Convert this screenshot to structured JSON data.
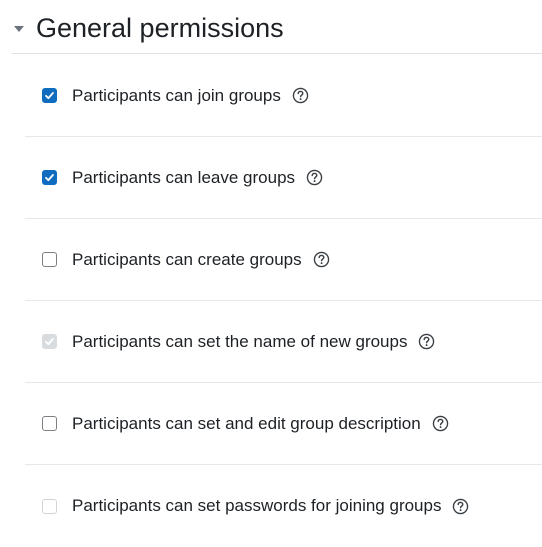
{
  "section": {
    "title": "General permissions",
    "icon": "caret-down-icon"
  },
  "permissions": [
    {
      "label": "Participants can join groups",
      "checked": true,
      "disabled": false
    },
    {
      "label": "Participants can leave groups",
      "checked": true,
      "disabled": false
    },
    {
      "label": "Participants can create groups",
      "checked": false,
      "disabled": false
    },
    {
      "label": "Participants can set the name of new groups",
      "checked": true,
      "disabled": true
    },
    {
      "label": "Participants can set and edit group description",
      "checked": false,
      "disabled": false
    },
    {
      "label": "Participants can set passwords for joining groups",
      "checked": false,
      "disabled": true
    }
  ],
  "icons": {
    "help": "question-circle-icon",
    "check": "checkmark-icon"
  },
  "colors": {
    "accent": "#0f6cbf",
    "disabled_check": "#d9dcdf",
    "text": "#1d2125",
    "divider": "#e6e9ec"
  }
}
